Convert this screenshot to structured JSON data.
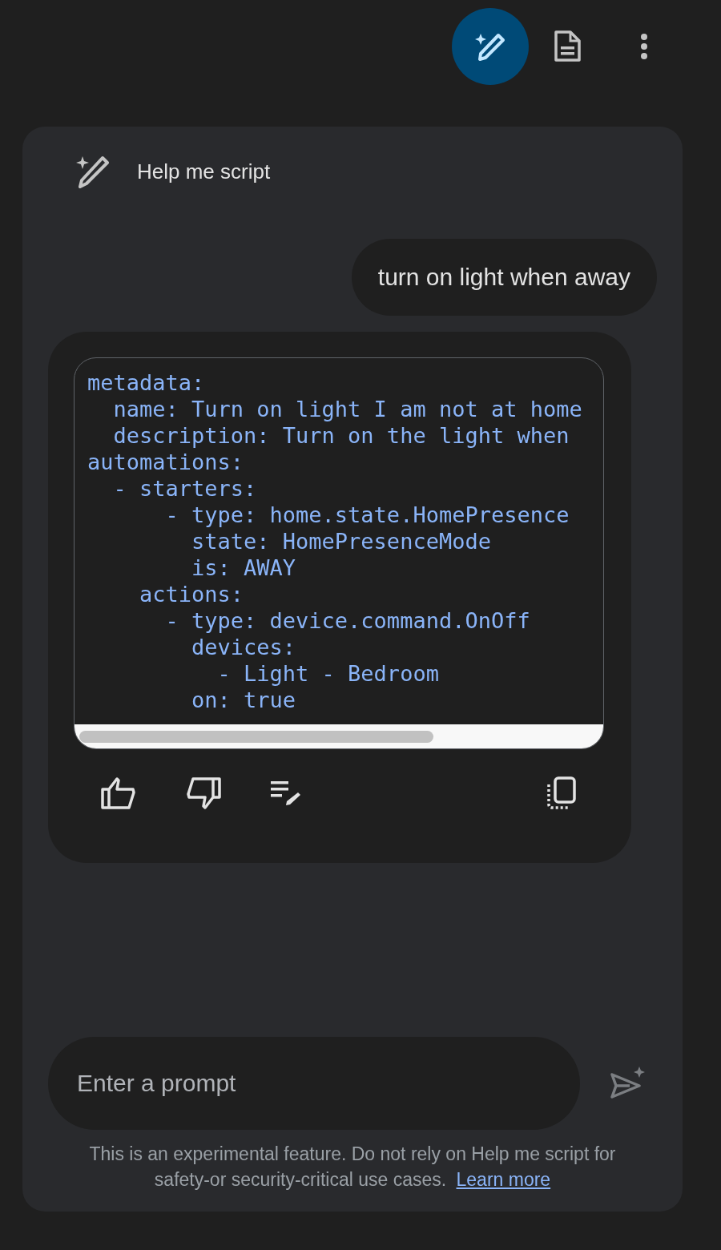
{
  "toolbar": [
    {
      "kind": "script",
      "selected": true
    },
    {
      "kind": "document",
      "selected": false
    },
    {
      "kind": "more",
      "selected": false
    }
  ],
  "panel": {
    "title": "Help me script",
    "user_message": "turn on light when away",
    "response": {
      "code_lines": [
        "metadata:",
        "  name: Turn on light I am not at home",
        "  description: Turn on the light when",
        "automations:",
        "  - starters:",
        "      - type: home.state.HomePresence",
        "        state: HomePresenceMode",
        "        is: AWAY",
        "    actions:",
        "      - type: device.command.OnOff",
        "        devices:",
        "          - Light - Bedroom",
        "        on: true"
      ],
      "actions": [
        {
          "kind": "like"
        },
        {
          "kind": "dislike"
        },
        {
          "kind": "edit"
        },
        {
          "kind": "copy"
        }
      ]
    },
    "prompt": {
      "placeholder": "Enter a prompt"
    },
    "disclaimer": "This is an experimental feature. Do not rely on Help me script for safety-or security-critical use cases.",
    "learn_more": "Learn more"
  }
}
